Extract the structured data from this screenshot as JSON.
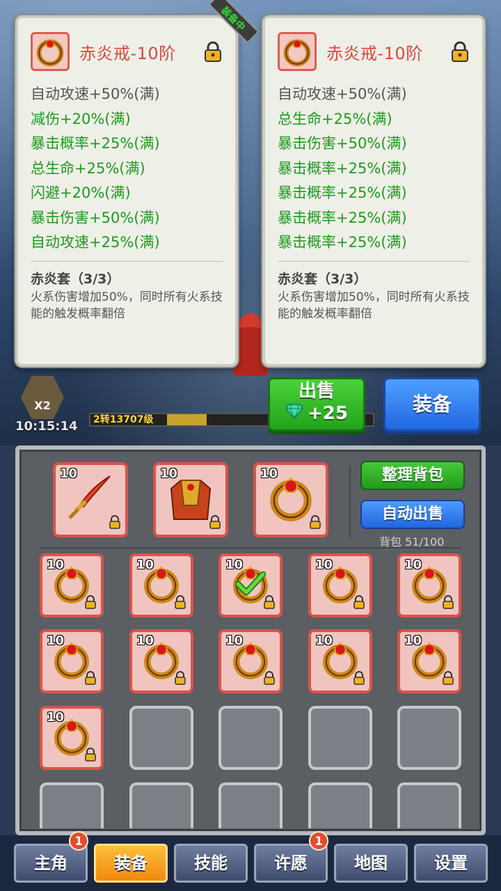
{
  "equipped_tag": "装备中",
  "card_left": {
    "title": "赤炎戒-10阶",
    "stats": [
      {
        "text": "自动攻速+50%(满)",
        "color": "grey"
      },
      {
        "text": "减伤+20%(满)",
        "color": "green"
      },
      {
        "text": "暴击概率+25%(满)",
        "color": "green"
      },
      {
        "text": "总生命+25%(满)",
        "color": "green"
      },
      {
        "text": "闪避+20%(满)",
        "color": "green"
      },
      {
        "text": "暴击伤害+50%(满)",
        "color": "green"
      },
      {
        "text": "自动攻速+25%(满)",
        "color": "green"
      }
    ],
    "set_title": "赤炎套（3/3）",
    "set_desc": "火系伤害增加50%，同时所有火系技能的触发概率翻倍"
  },
  "card_right": {
    "title": "赤炎戒-10阶",
    "stats": [
      {
        "text": "自动攻速+50%(满)",
        "color": "grey"
      },
      {
        "text": "总生命+25%(满)",
        "color": "green"
      },
      {
        "text": "暴击伤害+50%(满)",
        "color": "green"
      },
      {
        "text": "暴击概率+25%(满)",
        "color": "green"
      },
      {
        "text": "暴击概率+25%(满)",
        "color": "green"
      },
      {
        "text": "暴击概率+25%(满)",
        "color": "green"
      },
      {
        "text": "暴击概率+25%(满)",
        "color": "green"
      }
    ],
    "set_title": "赤炎套（3/3）",
    "set_desc": "火系伤害增加50%，同时所有火系技能的触发概率翻倍"
  },
  "hud": {
    "multiplier": "X2",
    "clock": "10:15:14",
    "level_text": "2转13707级",
    "level_progress": 0.14
  },
  "actions": {
    "sell_label": "出售",
    "sell_gain": "+25",
    "equip_label": "装备"
  },
  "inventory": {
    "sort_label": "整理背包",
    "auto_sell_label": "自动出售",
    "bag_count": "背包 51/100",
    "equipped_items": [
      {
        "level": "10",
        "kind": "sword"
      },
      {
        "level": "10",
        "kind": "armor"
      },
      {
        "level": "10",
        "kind": "ring"
      }
    ],
    "bag_levels": [
      "10",
      "10",
      "10",
      "10",
      "10",
      "10",
      "10",
      "10",
      "10",
      "10",
      "10"
    ]
  },
  "nav": [
    {
      "label": "主角",
      "badge": "1"
    },
    {
      "label": "装备",
      "badge": ""
    },
    {
      "label": "技能",
      "badge": ""
    },
    {
      "label": "许愿",
      "badge": "1"
    },
    {
      "label": "地图",
      "badge": ""
    },
    {
      "label": "设置",
      "badge": ""
    }
  ],
  "colors": {
    "stat_green": "#1f9a1f",
    "title_red": "#e0463a",
    "slot_red": "#d9534a",
    "nav_active": "#f08a10"
  }
}
